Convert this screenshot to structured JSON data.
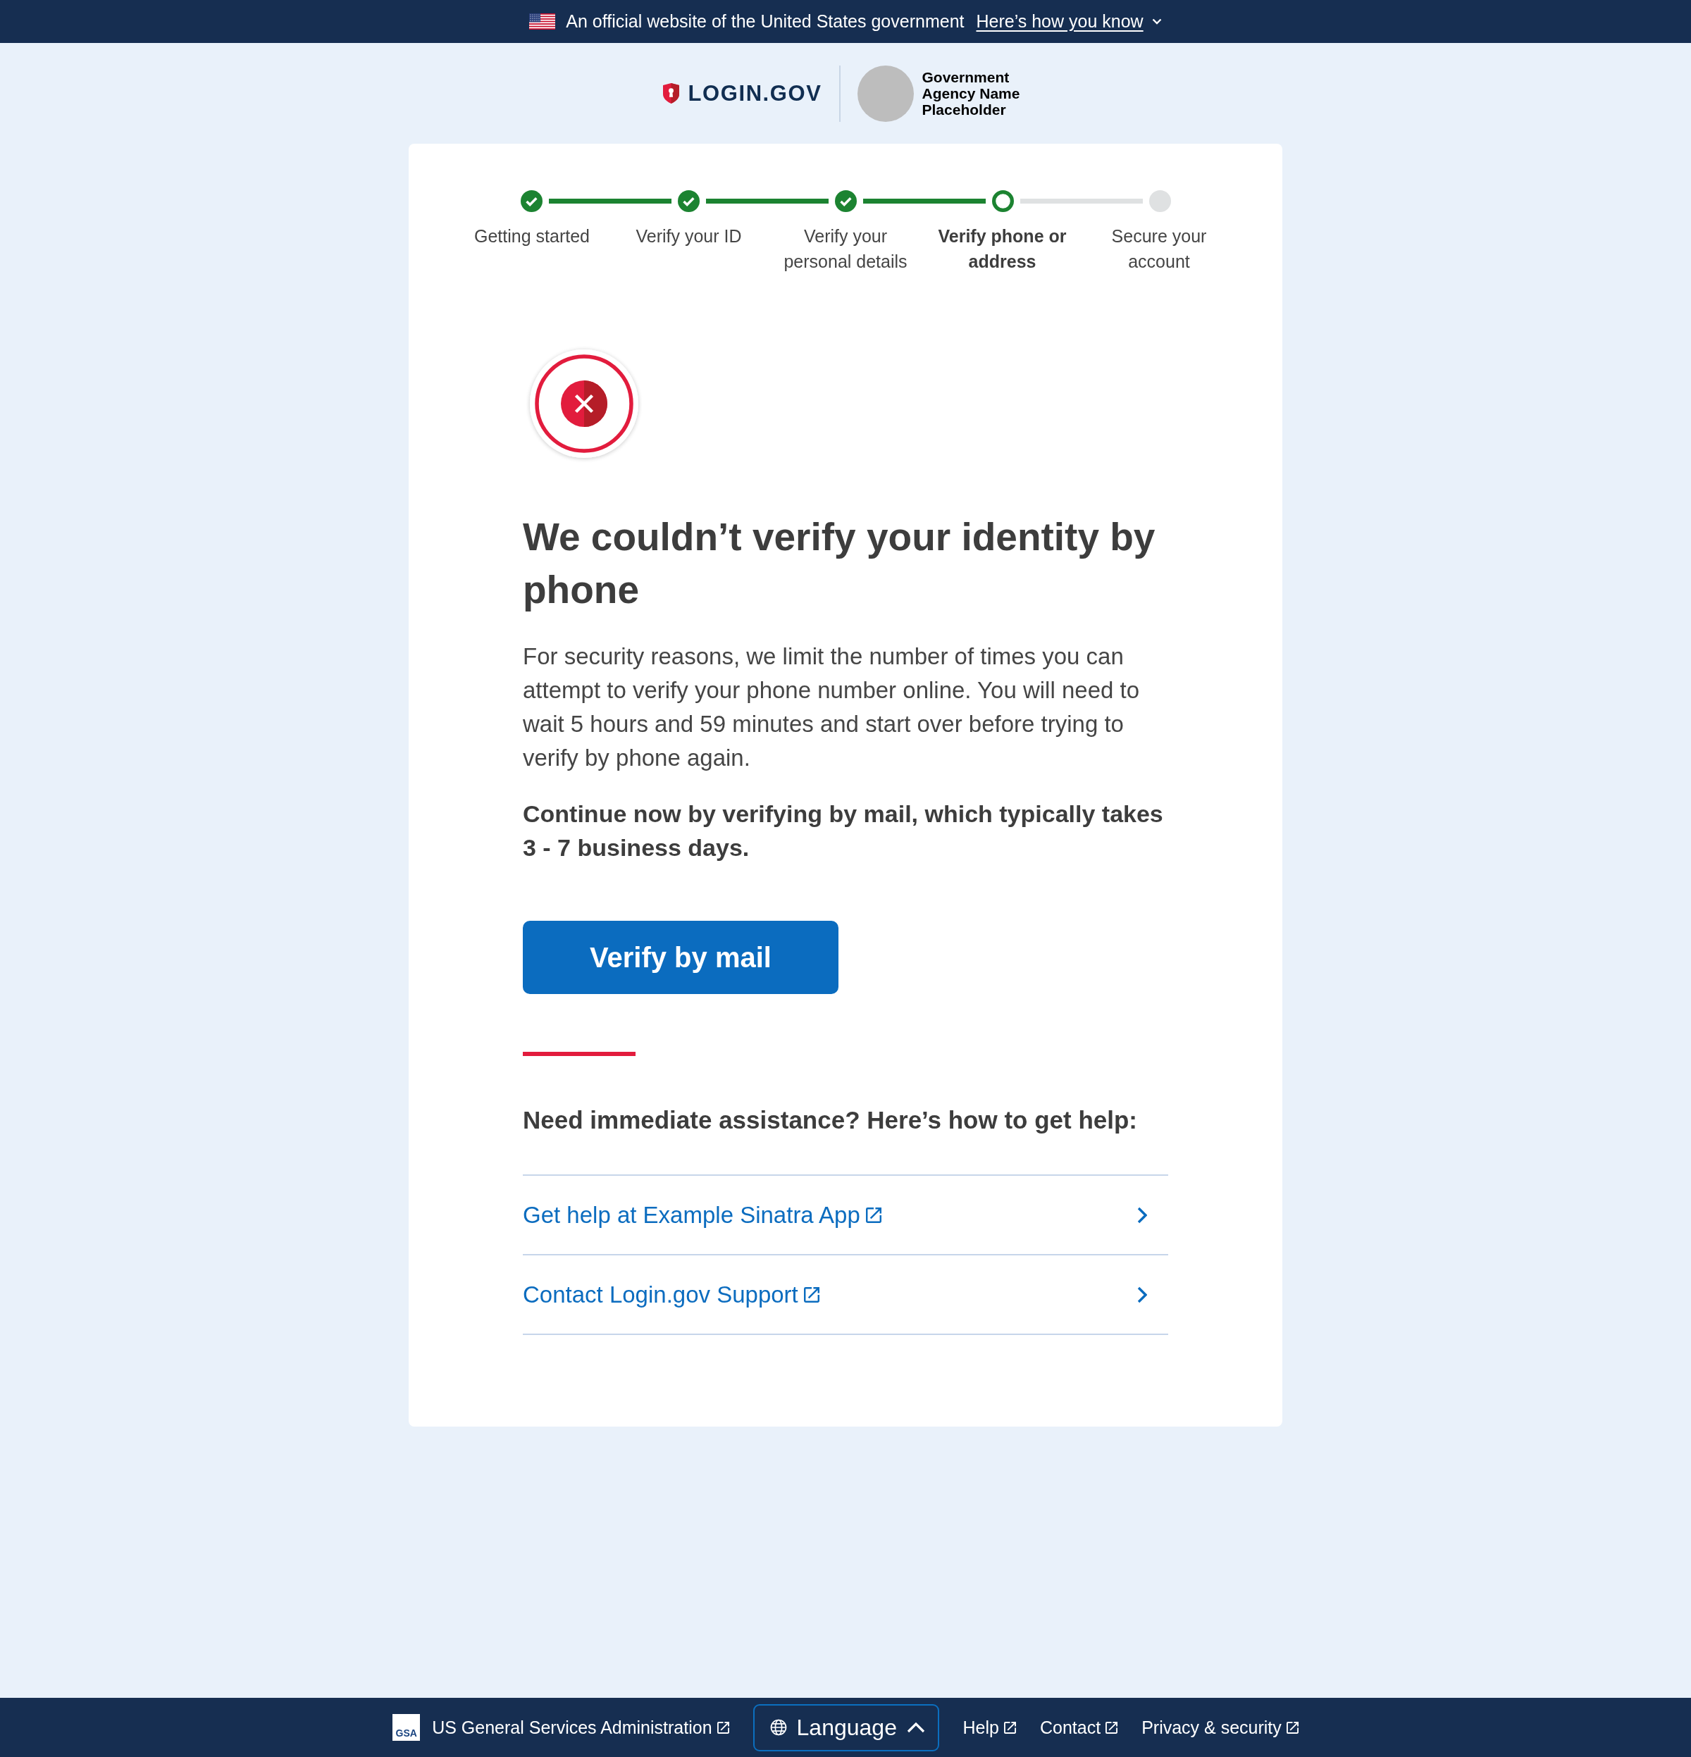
{
  "banner": {
    "text": "An official website of the United States government",
    "link": "Here’s how you know",
    "expanded": false
  },
  "header": {
    "logo_text": "LOGIN.GOV",
    "agency_name": "Government Agency Name Placeholder"
  },
  "steps": [
    {
      "label": "Getting started",
      "complete": true,
      "current": false
    },
    {
      "label": "Verify your ID",
      "complete": true,
      "current": false
    },
    {
      "label": "Verify your personal details",
      "complete": true,
      "current": false
    },
    {
      "label": "Verify phone or address",
      "complete": false,
      "current": true
    },
    {
      "label": "Secure your account",
      "complete": false,
      "current": false
    }
  ],
  "heading": "We couldn’t verify your identity by phone",
  "message": "For security reasons, we limit the number of times you can attempt to verify your phone number online. You will need to wait 5 hours and 59 minutes and start over before trying to verify by phone again.",
  "note": "Continue now by verifying by mail, which typically takes 3 - 7 business days.",
  "primary_button": "Verify by mail",
  "help": {
    "heading": "Need immediate assistance? Here’s how to get help:",
    "links": [
      {
        "label": "Get help at Example Sinatra App"
      },
      {
        "label": "Contact Login.gov Support"
      }
    ]
  },
  "footer": {
    "logo_text": "GSA",
    "agency_link": "US General Services Administration",
    "language_button": "Language",
    "links": [
      "Help",
      "Contact",
      "Privacy & security"
    ]
  }
}
